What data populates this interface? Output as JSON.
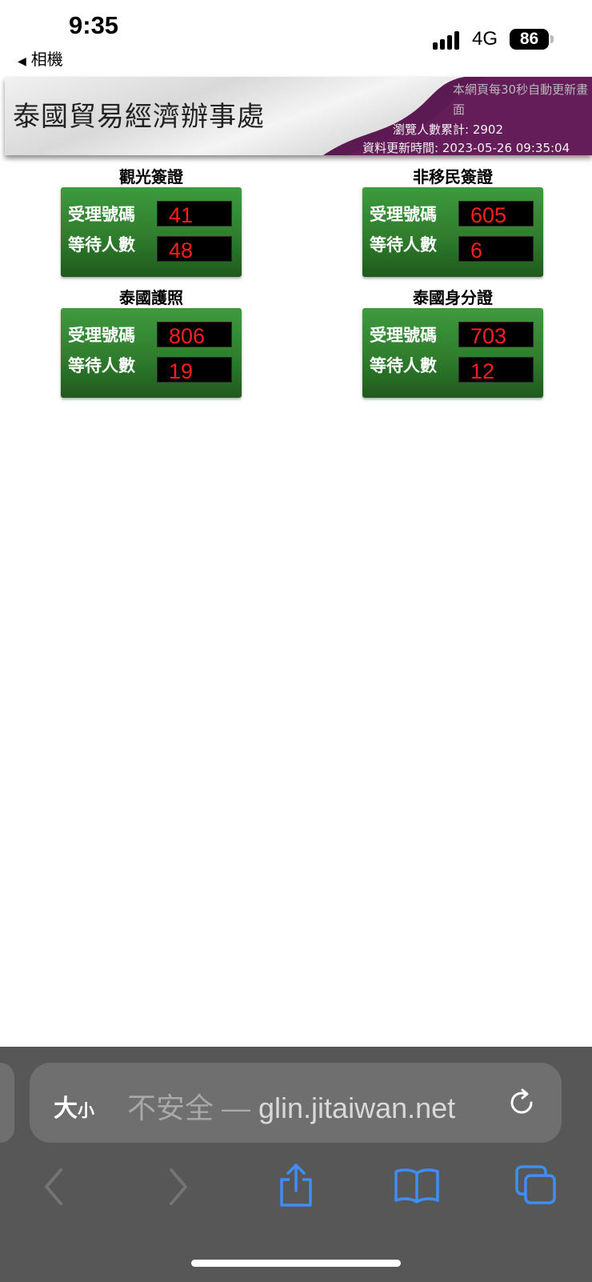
{
  "status_bar": {
    "time": "9:35",
    "back_app": "相機",
    "network": "4G",
    "battery": "86"
  },
  "banner": {
    "title": "泰國貿易經濟辦事處",
    "refresh_note": "本網頁每30秒自動更新畫面",
    "visitor_count": "瀏覽人數累計: 2902",
    "update_time": "資料更新時間: 2023-05-26 09:35:04"
  },
  "panels": [
    {
      "title": "觀光簽證",
      "serving_label": "受理號碼",
      "serving": "41",
      "waiting_label": "等待人數",
      "waiting": "48"
    },
    {
      "title": "非移民簽證",
      "serving_label": "受理號碼",
      "serving": "605",
      "waiting_label": "等待人數",
      "waiting": "6"
    },
    {
      "title": "泰國護照",
      "serving_label": "受理號碼",
      "serving": "806",
      "waiting_label": "等待人數",
      "waiting": "19"
    },
    {
      "title": "泰國身分證",
      "serving_label": "受理號碼",
      "serving": "703",
      "waiting_label": "等待人數",
      "waiting": "12"
    }
  ],
  "browser": {
    "text_size_big": "大",
    "text_size_small": "小",
    "url_prefix": "不安全 — ",
    "url_domain": "glin.jitaiwan.net",
    "accent_color": "#3f8ef5"
  }
}
